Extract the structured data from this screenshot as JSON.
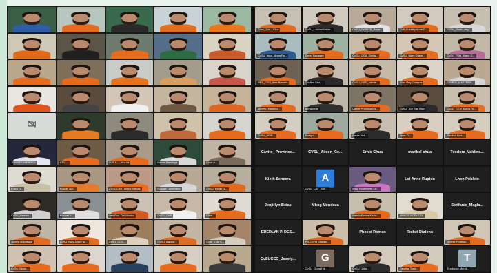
{
  "colors": {
    "accent": "#8bd36a",
    "tile_bg": "#1f1f1f",
    "panel_bg": "#121212"
  },
  "left_tiles": [
    {
      "name": "",
      "bg": "#3a5f44",
      "shirt": "#2f5ea8"
    },
    {
      "name": "",
      "bg": "#b7c7c0",
      "shirt": "#e56b1f"
    },
    {
      "name": "",
      "bg": "#3a6a4e",
      "shirt": "#2a2a2a"
    },
    {
      "name": "",
      "bg": "#c9d3d6",
      "shirt": "#e0701e"
    },
    {
      "name": "",
      "bg": "#9bb8a0",
      "shirt": "#e9781c"
    },
    {
      "name": "",
      "bg": "#cfc9b8",
      "shirt": "#e06a1a"
    },
    {
      "name": "",
      "bg": "#5b5548",
      "shirt": "#1f1f1f"
    },
    {
      "name": "",
      "bg": "#6c7b6c",
      "shirt": "#e56b1f"
    },
    {
      "name": "",
      "bg": "#556f8a",
      "shirt": "#2d6b43"
    },
    {
      "name": "",
      "bg": "#d9d3c4",
      "shirt": "#c95b2a"
    },
    {
      "name": "",
      "bg": "#b9a78b",
      "shirt": "#e56b1f"
    },
    {
      "name": "",
      "bg": "#7d6f5a",
      "shirt": "#e56b1f"
    },
    {
      "name": "",
      "bg": "#c8ccc8",
      "shirt": "#e7731d"
    },
    {
      "name": "",
      "bg": "#a39b8b",
      "shirt": "#d99e62"
    },
    {
      "name": "",
      "bg": "#d8d3cb",
      "shirt": "#c6564a"
    },
    {
      "name": "",
      "bg": "#eae6e0",
      "shirt": "#e0541e"
    },
    {
      "name": "",
      "bg": "#5a4c3c",
      "shirt": "#444444"
    },
    {
      "name": "",
      "bg": "#d2c6b8",
      "shirt": "#f0f0f0"
    },
    {
      "name": "",
      "bg": "#c5b79f",
      "shirt": "#6f5a41"
    },
    {
      "name": "",
      "bg": "#c7b399",
      "shirt": "#df6522"
    },
    {
      "name": "",
      "bg": "camoff",
      "shirt": ""
    },
    {
      "name": "",
      "bg": "#2d3a2c",
      "shirt": "#e57b22"
    },
    {
      "name": "",
      "bg": "#8e8a7e",
      "shirt": "#2b2b2b"
    },
    {
      "name": "",
      "bg": "#cfc2ab",
      "shirt": "#bf6a3c"
    },
    {
      "name": "",
      "bg": "#d5d6d1",
      "shirt": "#e56b1f"
    },
    {
      "name": "JONIEFE NIEBRES",
      "bg": "#24283a",
      "shirt": "#e4e4f0"
    },
    {
      "name": "CSU-...",
      "bg": "#6e5b46",
      "shirt": "#e56b1f"
    },
    {
      "name": "CvSU - ... Ara-lid",
      "bg": "#a89b8a",
      "shirt": "#e66a1c"
    },
    {
      "name": "Nemia Bardiaga",
      "bg": "#2e4a38",
      "shirt": "#d9d9d9"
    },
    {
      "name": "Cvsu A...",
      "bg": "#c0b5a4",
      "shirt": "#7a6a59"
    },
    {
      "name": "Fralia D...",
      "bg": "#dedbd2",
      "shirt": "#c9bfa6"
    },
    {
      "name": "Ruzzel Gin...",
      "bg": "#a89782",
      "shirt": "#e77a2a"
    },
    {
      "name": "CVSUCRR_Diana Arenas",
      "bg": "#ba9a86",
      "shirt": "#ea6c1c"
    },
    {
      "name": "Rosalie Laxamana",
      "bg": "#b7a996",
      "shirt": "#d6d6d6"
    },
    {
      "name": "CvSU_Elmer D...",
      "bg": "#b7ae9e",
      "shirt": "#e46a1c"
    },
    {
      "name": "CvSU_Hernan...",
      "bg": "#2e2b26",
      "shirt": "#cfcfcf"
    },
    {
      "name": "Marinel A...",
      "bg": "#8a8f94",
      "shirt": "#e0e0e0"
    },
    {
      "name": "Lani Fco. Del Mundo",
      "bg": "#c9c2b4",
      "shirt": "#d35a22"
    },
    {
      "name": "CvSU_CAS",
      "bg": "#c6b9a8",
      "shirt": "#f0f0f0"
    },
    {
      "name": "Ellen...",
      "bg": "#e0dbd2",
      "shirt": "#e56b1f"
    },
    {
      "name": "Jocelyn Dipasupil",
      "bg": "#bfb5a6",
      "shirt": "#e06c23"
    },
    {
      "name": "CvSU Mary Joyce Ar...",
      "bg": "#efe6de",
      "shirt": "#e56b1f"
    },
    {
      "name": "CvSU_CCS...",
      "bg": "#9c7e5c",
      "shirt": "#ddd1bd"
    },
    {
      "name": "CvSU_Bacoor...",
      "bg": "#c4b6a4",
      "shirt": "#e06b22"
    },
    {
      "name": "Cvsu_Lola C...",
      "bg": "#a6866a",
      "shirt": "#d7cdbf"
    },
    {
      "name": "CvSU Gibon...",
      "bg": "#d0c3b3",
      "shirt": "#e56b1f"
    },
    {
      "name": "",
      "bg": "#dcd6ce",
      "shirt": "#e56b1f"
    },
    {
      "name": "",
      "bg": "#b5bdc4",
      "shirt": "#27415e"
    },
    {
      "name": "",
      "bg": "#d6d0c4",
      "shirt": "#e56b1f"
    },
    {
      "name": "",
      "bg": "#b9a98f",
      "shirt": "#3b3b3b"
    }
  ],
  "right_tiles": [
    {
      "kind": "video",
      "name": "Cvsu_Jos... Cruz",
      "bg": "#c7c0b4",
      "shirt": "#e06b1f"
    },
    {
      "kind": "video",
      "name": "CvSU_Lalaine Melar...",
      "bg": "#d1cabf",
      "shirt": "#2c2c2c"
    },
    {
      "kind": "video",
      "name": "CvSU_CvSUTE_Rosa...",
      "bg": "#b7aa99",
      "shirt": "#e2e2e2"
    },
    {
      "kind": "video",
      "name": "CvSU Lesley Anne P...",
      "bg": "#d3cbc0",
      "shirt": "#e56b1f"
    },
    {
      "kind": "video",
      "name": "CvSU_Rosh...erg...",
      "bg": "#c7bfb1",
      "shirt": "#d8d8d8"
    },
    {
      "kind": "video",
      "name": "CvSU_Imus_Anna Pa...",
      "bg": "#a9bcc0",
      "shirt": "#2d5c90"
    },
    {
      "kind": "video",
      "name": "Elmer Bacasen",
      "bg": "#9fb3a3",
      "shirt": "#e56b1f"
    },
    {
      "kind": "video",
      "name": "CvSU_CGA_Eletta...",
      "bg": "#c8bca9",
      "shirt": "#e56b1f"
    },
    {
      "kind": "video",
      "name": "CvSU_Mary Grace...",
      "bg": "#d4c7b4",
      "shirt": "#e56b1f"
    },
    {
      "kind": "video",
      "name": "CvSU_FDN_Marie D...",
      "bg": "#c2b8a8",
      "shirt": "#b66d9c"
    },
    {
      "kind": "video",
      "name": "PEE_CSU_Ilme Rosario",
      "bg": "#6d6154",
      "shirt": "#e56b1f"
    },
    {
      "kind": "video",
      "name": "Caviles Gen, ...",
      "bg": "#c6bcaf",
      "shirt": "#2a2a2a"
    },
    {
      "kind": "video",
      "name": "CvSU_CAS_Jaimie...",
      "bg": "#c4b8a6",
      "shirt": "#e56b1f"
    },
    {
      "kind": "video",
      "name": "Gina Rey Campos",
      "bg": "#dbd3c7",
      "shirt": "#e56b1f"
    },
    {
      "kind": "video",
      "name": "CEMDS_MAYTEEN...",
      "bg": "#bba892",
      "shirt": "#d5d5d5"
    },
    {
      "kind": "video",
      "name": "Jocelyn Ramirez...",
      "bg": "#c9bfae",
      "shirt": "#e56b1f"
    },
    {
      "kind": "video",
      "name": "Bernadette",
      "bg": "#bdb8a9",
      "shirt": "#303030"
    },
    {
      "kind": "video",
      "name": "Cavite Province ML...",
      "bg": "#7e7466",
      "shirt": "#e56b1f"
    },
    {
      "kind": "video",
      "name": "CvSU_Jun San Rian",
      "bg": "#5a4d40",
      "shirt": "#2b2b2b"
    },
    {
      "kind": "video",
      "name": "CvSU_CCN_Maria Ra...",
      "bg": "#c9bfae",
      "shirt": "#e56b1f"
    },
    {
      "kind": "video",
      "name": "CvSU_NOR...",
      "bg": "#d4cdc2",
      "shirt": "#e56b1f"
    },
    {
      "kind": "video",
      "name": "Evelyn ...",
      "bg": "#9ea9a0",
      "shirt": "#e56b1f"
    },
    {
      "kind": "video",
      "name": "Paula Vict...",
      "bg": "#c9bfb0",
      "shirt": "#2c2c2c"
    },
    {
      "kind": "video",
      "name": "Jane Cr...",
      "bg": "#d8cfc2",
      "shirt": "#e56b1f"
    },
    {
      "kind": "video",
      "name": "Paulina Lola...",
      "bg": "#d6cdc1",
      "shirt": "#e56b1f"
    },
    {
      "kind": "name",
      "label": "Cavite_ Province..."
    },
    {
      "kind": "name",
      "label": "CVSU_Aileen_Ce..."
    },
    {
      "kind": "name",
      "label": "Ernie Chua"
    },
    {
      "kind": "name",
      "label": "maribel chua"
    },
    {
      "kind": "name",
      "label": "Teodora_Valdera..."
    },
    {
      "kind": "name",
      "label": "Kieth Sencera"
    },
    {
      "kind": "letter",
      "letter": "A",
      "color": "#2e7dd8",
      "name": "CvSU_CAT_Abe..."
    },
    {
      "kind": "video",
      "name": "imus Rosemarie Ch...",
      "bg": "#6a5a82",
      "shirt": "#c876c0"
    },
    {
      "kind": "name",
      "label": "Loi Anne Rupido"
    },
    {
      "kind": "name",
      "label": "Lhen Poblete"
    },
    {
      "kind": "name",
      "label": "Jenjirlyn Beias"
    },
    {
      "kind": "name",
      "label": "Mhog Mendoza"
    },
    {
      "kind": "video",
      "name": "Kaireh Rosca Abalo...",
      "bg": "#c7bfae",
      "shirt": "#e56b1f"
    },
    {
      "kind": "video",
      "name": "JANICE NOBLESA",
      "bg": "#e1dccf",
      "shirt": "#d8c9a8"
    },
    {
      "kind": "name",
      "label": "Steffanie_Magla..."
    },
    {
      "kind": "name",
      "label": "EDERLYN P. DES..."
    },
    {
      "kind": "video",
      "name": "PB-CSFR_Darian...",
      "bg": "#cbbfa9",
      "shirt": "#e56b1f"
    },
    {
      "kind": "name",
      "label": "Phoebi Roman"
    },
    {
      "kind": "name",
      "label": "Richel Dioleno"
    },
    {
      "kind": "video",
      "name": "Stymie Portillon...",
      "bg": "#d0c6b6",
      "shirt": "#e56b1f"
    },
    {
      "kind": "name",
      "label": "CvSUCCC_Jocely..."
    },
    {
      "kind": "letter",
      "letter": "G",
      "color": "#7a6b5e",
      "name": "CvSU_Gong Ha..."
    },
    {
      "kind": "video",
      "name": "CvSU_Jobs...",
      "bg": "#d4cabd",
      "shirt": "#2d2d2d"
    },
    {
      "kind": "video",
      "name": "Cecelia_Dela...",
      "bg": "#d3cbbe",
      "shirt": "#e56b1f"
    },
    {
      "kind": "letter",
      "letter": "T",
      "color": "#8fa5b2",
      "name": "Teodorico Mend..."
    }
  ]
}
